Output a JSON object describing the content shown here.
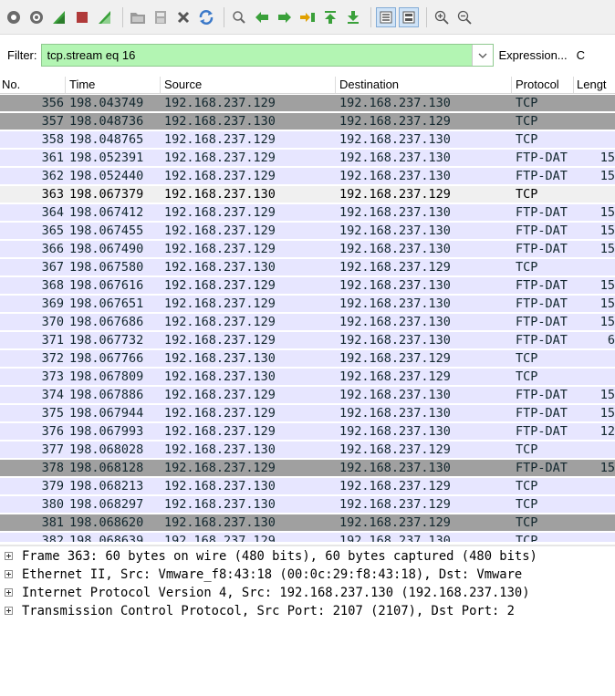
{
  "colors": {
    "tcp_default": "#e7e6ff",
    "tcp_problem": "#a0a0a0",
    "selected": "#f0f0f0",
    "filter_valid": "#b3f5b3"
  },
  "toolbar": {
    "icons": [
      "start-capture-icon",
      "capture-options-icon",
      "shark-fin-blue-icon",
      "stop-capture-icon",
      "restart-capture-icon",
      "open-file-icon",
      "save-file-icon",
      "close-file-icon",
      "reload-icon",
      "find-packet-icon",
      "go-back-icon",
      "go-forward-icon",
      "go-to-packet-icon",
      "first-packet-icon",
      "last-packet-icon",
      "autoscroll-icon",
      "colorize-icon",
      "zoom-in-icon",
      "zoom-out-icon"
    ]
  },
  "filter": {
    "label": "Filter:",
    "value": "tcp.stream eq 16",
    "expression_label": "Expression...",
    "extra": "C"
  },
  "columns": [
    "No.",
    "Time",
    "Source",
    "Destination",
    "Protocol",
    "Lengt"
  ],
  "rows": [
    {
      "no": "356",
      "time": "198.043749",
      "src": "192.168.237.129",
      "dst": "192.168.237.130",
      "proto": "TCP",
      "len": "",
      "style": "problem"
    },
    {
      "no": "357",
      "time": "198.048736",
      "src": "192.168.237.130",
      "dst": "192.168.237.129",
      "proto": "TCP",
      "len": "",
      "style": "problem"
    },
    {
      "no": "358",
      "time": "198.048765",
      "src": "192.168.237.129",
      "dst": "192.168.237.130",
      "proto": "TCP",
      "len": "",
      "style": "tcp"
    },
    {
      "no": "361",
      "time": "198.052391",
      "src": "192.168.237.129",
      "dst": "192.168.237.130",
      "proto": "FTP-DAT",
      "len": "15",
      "style": "tcp"
    },
    {
      "no": "362",
      "time": "198.052440",
      "src": "192.168.237.129",
      "dst": "192.168.237.130",
      "proto": "FTP-DAT",
      "len": "15",
      "style": "tcp"
    },
    {
      "no": "363",
      "time": "198.067379",
      "src": "192.168.237.130",
      "dst": "192.168.237.129",
      "proto": "TCP",
      "len": "",
      "style": "selected"
    },
    {
      "no": "364",
      "time": "198.067412",
      "src": "192.168.237.129",
      "dst": "192.168.237.130",
      "proto": "FTP-DAT",
      "len": "15",
      "style": "tcp"
    },
    {
      "no": "365",
      "time": "198.067455",
      "src": "192.168.237.129",
      "dst": "192.168.237.130",
      "proto": "FTP-DAT",
      "len": "15",
      "style": "tcp"
    },
    {
      "no": "366",
      "time": "198.067490",
      "src": "192.168.237.129",
      "dst": "192.168.237.130",
      "proto": "FTP-DAT",
      "len": "15",
      "style": "tcp"
    },
    {
      "no": "367",
      "time": "198.067580",
      "src": "192.168.237.130",
      "dst": "192.168.237.129",
      "proto": "TCP",
      "len": "",
      "style": "tcp"
    },
    {
      "no": "368",
      "time": "198.067616",
      "src": "192.168.237.129",
      "dst": "192.168.237.130",
      "proto": "FTP-DAT",
      "len": "15",
      "style": "tcp"
    },
    {
      "no": "369",
      "time": "198.067651",
      "src": "192.168.237.129",
      "dst": "192.168.237.130",
      "proto": "FTP-DAT",
      "len": "15",
      "style": "tcp"
    },
    {
      "no": "370",
      "time": "198.067686",
      "src": "192.168.237.129",
      "dst": "192.168.237.130",
      "proto": "FTP-DAT",
      "len": "15",
      "style": "tcp"
    },
    {
      "no": "371",
      "time": "198.067732",
      "src": "192.168.237.129",
      "dst": "192.168.237.130",
      "proto": "FTP-DAT",
      "len": "6",
      "style": "tcp"
    },
    {
      "no": "372",
      "time": "198.067766",
      "src": "192.168.237.130",
      "dst": "192.168.237.129",
      "proto": "TCP",
      "len": "",
      "style": "tcp"
    },
    {
      "no": "373",
      "time": "198.067809",
      "src": "192.168.237.130",
      "dst": "192.168.237.129",
      "proto": "TCP",
      "len": "",
      "style": "tcp"
    },
    {
      "no": "374",
      "time": "198.067886",
      "src": "192.168.237.129",
      "dst": "192.168.237.130",
      "proto": "FTP-DAT",
      "len": "15",
      "style": "tcp"
    },
    {
      "no": "375",
      "time": "198.067944",
      "src": "192.168.237.129",
      "dst": "192.168.237.130",
      "proto": "FTP-DAT",
      "len": "15",
      "style": "tcp"
    },
    {
      "no": "376",
      "time": "198.067993",
      "src": "192.168.237.129",
      "dst": "192.168.237.130",
      "proto": "FTP-DAT",
      "len": "12",
      "style": "tcp"
    },
    {
      "no": "377",
      "time": "198.068028",
      "src": "192.168.237.130",
      "dst": "192.168.237.129",
      "proto": "TCP",
      "len": "",
      "style": "tcp"
    },
    {
      "no": "378",
      "time": "198.068128",
      "src": "192.168.237.129",
      "dst": "192.168.237.130",
      "proto": "FTP-DAT",
      "len": "15",
      "style": "problem"
    },
    {
      "no": "379",
      "time": "198.068213",
      "src": "192.168.237.130",
      "dst": "192.168.237.129",
      "proto": "TCP",
      "len": "",
      "style": "tcp"
    },
    {
      "no": "380",
      "time": "198.068297",
      "src": "192.168.237.130",
      "dst": "192.168.237.129",
      "proto": "TCP",
      "len": "",
      "style": "tcp"
    },
    {
      "no": "381",
      "time": "198.068620",
      "src": "192.168.237.130",
      "dst": "192.168.237.129",
      "proto": "TCP",
      "len": "",
      "style": "problem"
    },
    {
      "no": "382",
      "time": "198.068639",
      "src": "192.168.237.129",
      "dst": "192.168.237.130",
      "proto": "TCP",
      "len": "",
      "style": "tcp"
    }
  ],
  "details": [
    "Frame 363: 60 bytes on wire (480 bits), 60 bytes captured (480 bits)",
    "Ethernet II, Src: Vmware_f8:43:18 (00:0c:29:f8:43:18), Dst: Vmware",
    "Internet Protocol Version 4, Src: 192.168.237.130 (192.168.237.130)",
    "Transmission Control Protocol, Src Port: 2107 (2107), Dst Port: 2"
  ]
}
